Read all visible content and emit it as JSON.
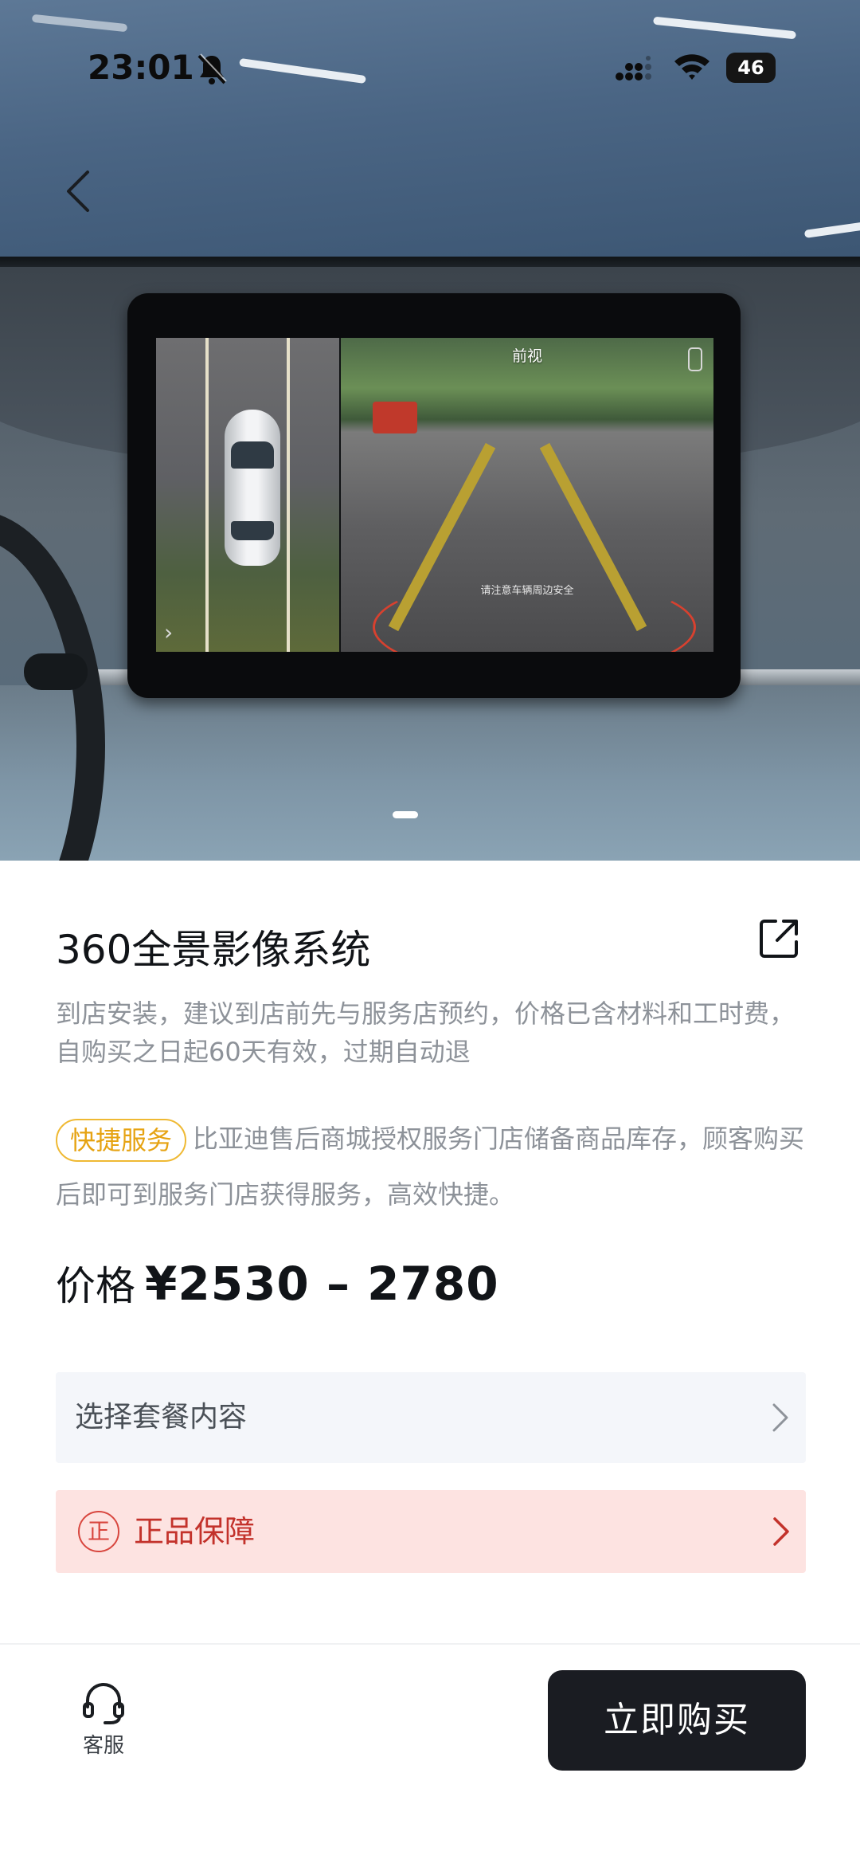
{
  "status_bar": {
    "time": "23:01",
    "battery": "46"
  },
  "hero": {
    "screen_label": "前视",
    "screen_caption": "请注意车辆周边安全",
    "page_indicator": {
      "current": 1,
      "total": 1
    }
  },
  "product": {
    "title": "360全景影像系统",
    "description": "到店安装，建议到店前先与服务店预约，价格已含材料和工时费，自购买之日起60天有效，过期自动退",
    "service_badge": "快捷服务",
    "service_text": "比亚迪售后商城授权服务门店储备商品库存，顾客购买后即可到服务门店获得服务，高效快捷。",
    "price_label": "价格",
    "price_value": "¥2530 – 2780"
  },
  "options": {
    "package_label": "选择套餐内容",
    "guarantee_icon_text": "正",
    "guarantee_label": "正品保障"
  },
  "bottom_bar": {
    "customer_service_label": "客服",
    "buy_button_label": "立即购买"
  },
  "colors": {
    "accent_badge": "#efb933",
    "guarantee_bg": "#fde3e1",
    "guarantee_text": "#c3322b",
    "buy_button_bg": "#1a1c22"
  },
  "icons": [
    "back-icon",
    "bell-muted-icon",
    "signal-icon",
    "wifi-icon",
    "share-icon",
    "chevron-right-icon",
    "headset-icon"
  ]
}
